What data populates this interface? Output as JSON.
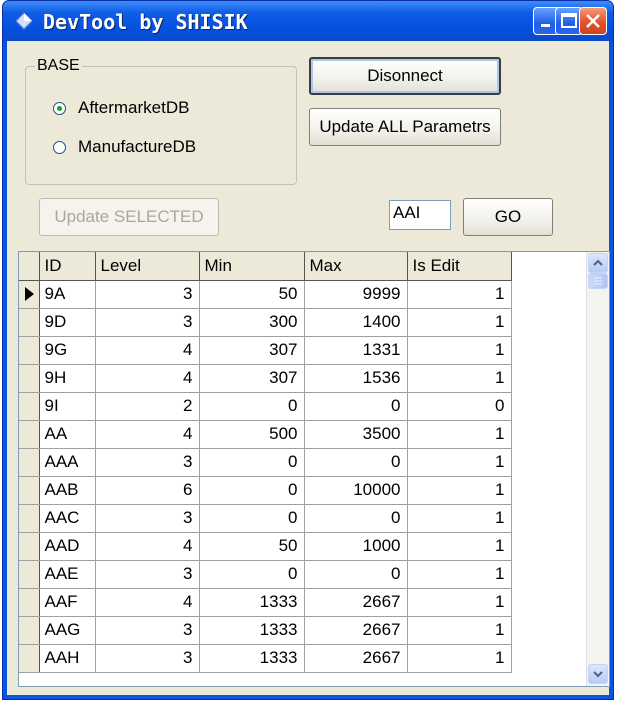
{
  "window": {
    "title": "DevTool by SHISIK"
  },
  "base_group": {
    "label": "BASE",
    "options": [
      {
        "label": "AftermarketDB",
        "selected": true
      },
      {
        "label": "ManufactureDB",
        "selected": false
      }
    ]
  },
  "buttons": {
    "disconnect": "Disonnect",
    "update_all": "Update ALL Parametrs",
    "update_selected": "Update SELECTED",
    "go": "GO"
  },
  "search": {
    "value": "AAI"
  },
  "grid": {
    "columns": [
      "ID",
      "Level",
      "Min",
      "Max",
      "Is Edit"
    ],
    "rows": [
      [
        "9A",
        "3",
        "50",
        "9999",
        "1"
      ],
      [
        "9D",
        "3",
        "300",
        "1400",
        "1"
      ],
      [
        "9G",
        "4",
        "307",
        "1331",
        "1"
      ],
      [
        "9H",
        "4",
        "307",
        "1536",
        "1"
      ],
      [
        "9I",
        "2",
        "0",
        "0",
        "0"
      ],
      [
        "AA",
        "4",
        "500",
        "3500",
        "1"
      ],
      [
        "AAA",
        "3",
        "0",
        "0",
        "1"
      ],
      [
        "AAB",
        "6",
        "0",
        "10000",
        "1"
      ],
      [
        "AAC",
        "3",
        "0",
        "0",
        "1"
      ],
      [
        "AAD",
        "4",
        "50",
        "1000",
        "1"
      ],
      [
        "AAE",
        "3",
        "0",
        "0",
        "1"
      ],
      [
        "AAF",
        "4",
        "1333",
        "2667",
        "1"
      ],
      [
        "AAG",
        "3",
        "1333",
        "2667",
        "1"
      ],
      [
        "AAH",
        "3",
        "1333",
        "2667",
        "1"
      ]
    ],
    "current_row": 0
  },
  "icons": {
    "app": "diamond-app-icon",
    "minimize": "minimize-icon",
    "maximize": "maximize-icon",
    "close": "close-icon",
    "row_pointer": "triangle-right-icon",
    "scroll_up": "chevron-up-icon",
    "scroll_down": "chevron-down-icon"
  },
  "colors": {
    "titlebar": "#0650de",
    "face": "#ece9d8",
    "close": "#e2502c"
  }
}
